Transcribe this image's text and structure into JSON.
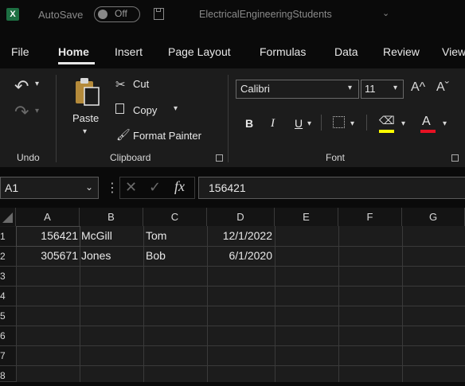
{
  "titlebar": {
    "app_icon": "X",
    "autosave_label": "AutoSave",
    "autosave_state": "Off",
    "document_title": "ElectricalEngineeringStudents",
    "title_chevron": "⌄"
  },
  "tabs": [
    "File",
    "Home",
    "Insert",
    "Page Layout",
    "Formulas",
    "Data",
    "Review",
    "View"
  ],
  "ribbon": {
    "undo_label": "Undo",
    "undo_icon": "↶",
    "redo_icon": "↷",
    "paste_label": "Paste",
    "cut_label": "Cut",
    "copy_label": "Copy",
    "format_painter_label": "Format Painter",
    "clipboard_label": "Clipboard",
    "font_label": "Font",
    "font_name": "Calibri",
    "font_size": "11",
    "grow_font": "A^",
    "shrink_font": "Aˇ",
    "bold": "B",
    "italic": "I",
    "underline": "U",
    "font_color": "A",
    "fill_color_accent": "#ffff00",
    "font_color_accent": "#e81123"
  },
  "formula_bar": {
    "name_box": "A1",
    "fx": "fx",
    "value": "156421"
  },
  "grid": {
    "columns": [
      "A",
      "B",
      "C",
      "D",
      "E",
      "F",
      "G"
    ],
    "rows": [
      "1",
      "2",
      "3",
      "4",
      "5",
      "6",
      "7",
      "8"
    ],
    "data": [
      {
        "a": "156421",
        "b": "McGill",
        "c": "Tom",
        "d": "12/1/2022"
      },
      {
        "a": "305671",
        "b": "Jones",
        "c": "Bob",
        "d": "6/1/2020"
      }
    ]
  }
}
